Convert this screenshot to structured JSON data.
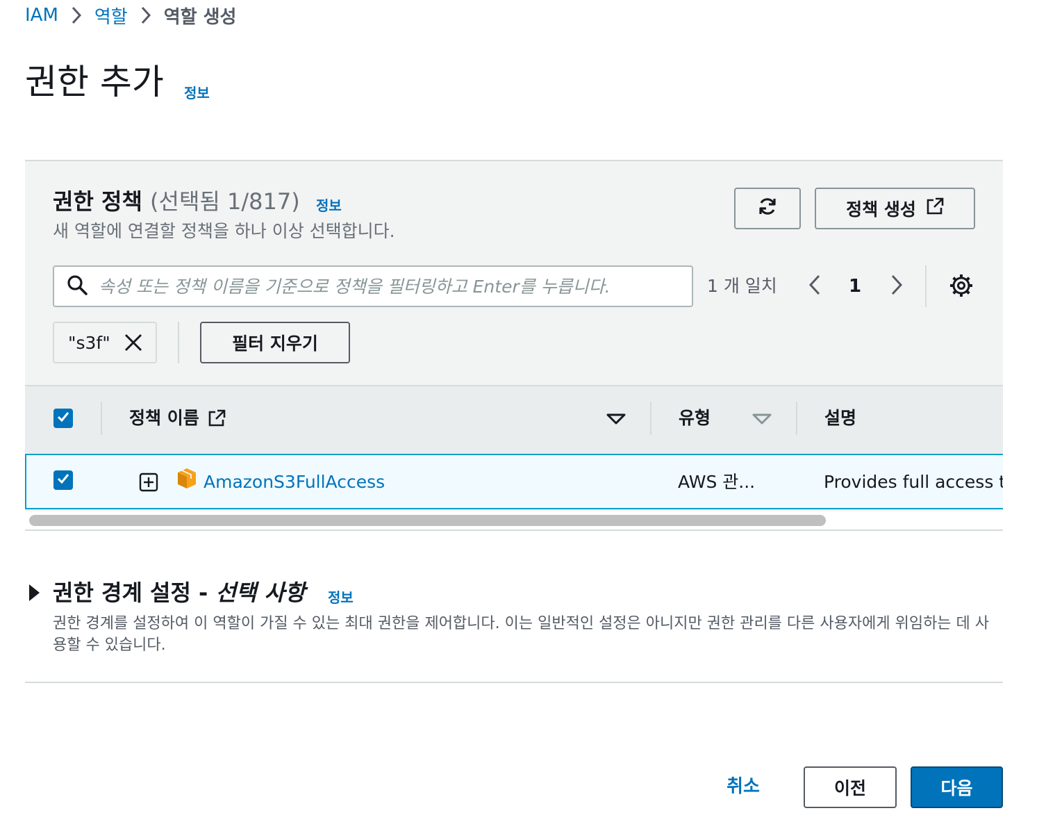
{
  "breadcrumb": {
    "items": [
      "IAM",
      "역할"
    ],
    "current": "역할 생성"
  },
  "page": {
    "title": "권한 추가",
    "info": "정보"
  },
  "policies": {
    "title": "권한 정책",
    "count": "(선택됨 1/817)",
    "info": "정보",
    "description": "새 역할에 연결할 정책을 하나 이상 선택합니다.",
    "create_policy_label": "정책 생성",
    "search": {
      "placeholder": "속성 또는 정책 이름을 기준으로 정책을 필터링하고 Enter를 누릅니다."
    },
    "match_count": "1 개 일치",
    "current_page": "1",
    "filter_token": "\"s3f\"",
    "clear_filters_label": "필터 지우기",
    "columns": {
      "name": "정책 이름",
      "type": "유형",
      "description": "설명"
    },
    "rows": [
      {
        "name": "AmazonS3FullAccess",
        "type": "AWS 관...",
        "description": "Provides full access t",
        "selected": true
      }
    ]
  },
  "boundary": {
    "title_main": "권한 경계 설정 - ",
    "title_optional": "선택 사항",
    "info": "정보",
    "description": "권한 경계를 설정하여 이 역할이 가질 수 있는 최대 권한을 제어합니다. 이는 일반적인 설정은 아니지만 권한 관리를 다른 사용자에게 위임하는 데 사용할 수 있습니다."
  },
  "footer": {
    "cancel_label": "취소",
    "previous_label": "이전",
    "next_label": "다음"
  },
  "colors": {
    "link": "#0073bb",
    "primary": "#0073bb",
    "panel_bg": "#f2f3f3",
    "selected_row_bg": "#f1faff",
    "selected_row_border": "#00a1c9",
    "aws_orange": "#f7a21b"
  },
  "icons": [
    "chevron-right-icon",
    "refresh-icon",
    "external-link-icon",
    "search-icon",
    "chevron-left-icon",
    "settings-gear-icon",
    "close-icon",
    "caret-down-icon",
    "expand-plus-icon",
    "aws-policy-cube-icon",
    "caret-right-icon",
    "check-icon"
  ]
}
